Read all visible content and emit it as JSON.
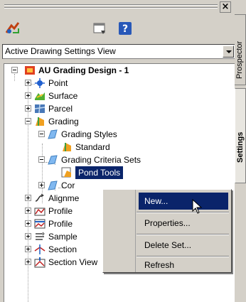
{
  "panel": {
    "close_glyph": "×",
    "toolbar": {
      "icons": [
        "drawing-settings-icon",
        "new-window-icon",
        "help-icon"
      ]
    },
    "view_select": {
      "value": "Active Drawing Settings View"
    }
  },
  "side_tabs": {
    "prospector": "Prospector",
    "settings": "Settings"
  },
  "tree": {
    "root": "AU Grading Design - 1",
    "point": "Point",
    "surface": "Surface",
    "parcel": "Parcel",
    "grading": "Grading",
    "grading_styles": "Grading Styles",
    "standard": "Standard",
    "criteria_sets": "Grading Criteria Sets",
    "pond_tools": "Pond Tools",
    "cor": "Cor",
    "alignment": "Alignme",
    "profile1": "Profile",
    "profile2": "Profile",
    "sample": "Sample",
    "section1": "Section",
    "section2": "Section View"
  },
  "context_menu": {
    "items": [
      "New...",
      "Properties...",
      "Delete Set...",
      "Refresh"
    ],
    "highlighted": "New..."
  },
  "colors": {
    "selection": "#0a246a",
    "panel": "#d4d0c8"
  }
}
